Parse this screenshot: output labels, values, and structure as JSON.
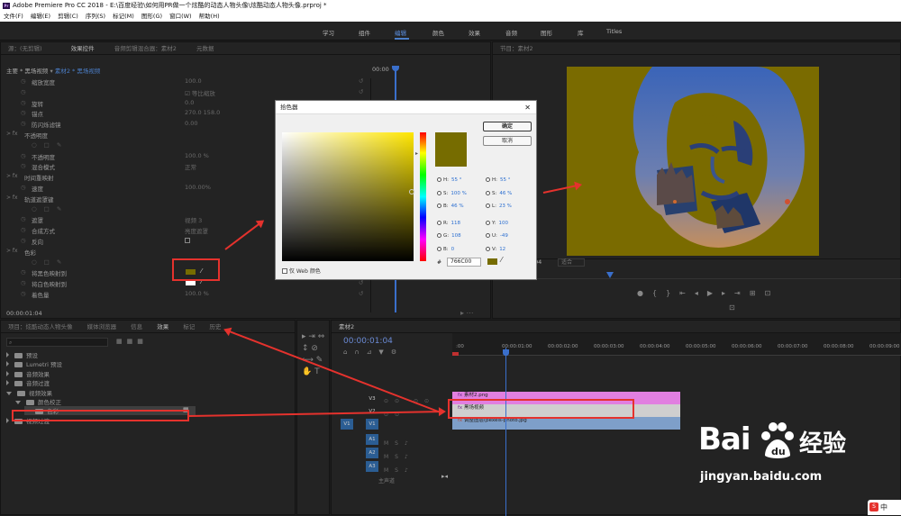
{
  "app_title": "Adobe Premiere Pro CC 2018 - E:\\百度经验\\如何用PR做一个炫酷的动态人物头像\\炫酷动态人物头像.prproj *",
  "menu": [
    "文件(F)",
    "编辑(E)",
    "剪辑(C)",
    "序列(S)",
    "标记(M)",
    "图形(G)",
    "窗口(W)",
    "帮助(H)"
  ],
  "workspaces": [
    "学习",
    "组件",
    "编辑",
    "颜色",
    "效果",
    "音频",
    "图形",
    "库",
    "Titles"
  ],
  "active_workspace": "编辑",
  "effect_controls": {
    "tabs": [
      "源：(无剪辑)",
      "效果控件",
      "音频剪辑混合器：素材2",
      "元数据"
    ],
    "clip_path": "主要 * 黑场视频",
    "clip_sel": "素材2 * 黑场视频",
    "timecode_right": "00:00",
    "rows": [
      {
        "label": "缩放宽度",
        "value": "100.0",
        "kind": "dim"
      },
      {
        "label": "",
        "value": "等比缩放",
        "kind": "check"
      },
      {
        "label": "旋转",
        "value": "0.0",
        "kind": "dim"
      },
      {
        "label": "锚点",
        "value": "270.0     158.0",
        "kind": "dim"
      },
      {
        "label": "防闪烁滤镜",
        "value": "0.00",
        "kind": "dim"
      },
      {
        "label": "不透明度",
        "value": "",
        "kind": "fx"
      },
      {
        "label": "",
        "value": "",
        "kind": "mask"
      },
      {
        "label": "不透明度",
        "value": "100.0 %",
        "kind": "dim"
      },
      {
        "label": "混合模式",
        "value": "正常",
        "kind": "dim"
      },
      {
        "label": "时间重映射",
        "value": "",
        "kind": "fx"
      },
      {
        "label": "速度",
        "value": "100.00%",
        "kind": "dim"
      },
      {
        "label": "轨道遮罩键",
        "value": "",
        "kind": "fx"
      },
      {
        "label": "",
        "value": "",
        "kind": "mask"
      },
      {
        "label": "遮罩",
        "value": "视频 3",
        "kind": "dim"
      },
      {
        "label": "合成方式",
        "value": "亮度遮罩",
        "kind": "dim"
      },
      {
        "label": "反向",
        "value": "",
        "kind": "box"
      },
      {
        "label": "色彩",
        "value": "",
        "kind": "fx"
      },
      {
        "label": "",
        "value": "",
        "kind": "mask"
      },
      {
        "label": "将黑色映射到",
        "value": "",
        "kind": "swatch-olive"
      },
      {
        "label": "将白色映射到",
        "value": "",
        "kind": "swatch-white"
      },
      {
        "label": "着色量",
        "value": "100.0 %",
        "kind": "dim"
      }
    ],
    "timecode": "00:00:01:04"
  },
  "color_picker": {
    "title": "拾色器",
    "ok": "确定",
    "cancel": "取消",
    "hsb_left": [
      [
        "H",
        "55 °"
      ],
      [
        "S",
        "100 %"
      ],
      [
        "B",
        "46 %"
      ],
      [
        "R",
        "118"
      ],
      [
        "G",
        "108"
      ],
      [
        "B",
        "0"
      ]
    ],
    "hsb_right": [
      [
        "H",
        "55 °"
      ],
      [
        "S",
        "46 %"
      ],
      [
        "L",
        "23 %"
      ],
      [
        "Y",
        "100"
      ],
      [
        "U",
        "-49"
      ],
      [
        "V",
        "12"
      ]
    ],
    "hex_label": "#",
    "hex_value": "766C00",
    "web_only": "仅 Web 颜色",
    "color": "#766C00"
  },
  "program_monitor": {
    "title": "节目：素材2",
    "timecode": "04",
    "fit": "适合"
  },
  "project_panel": {
    "tabs": [
      "项目：炫酷动态人物头像",
      "媒体浏览器",
      "信息",
      "效果",
      "标记",
      "历史"
    ],
    "items": [
      {
        "label": "预设",
        "indent": 0,
        "open": false
      },
      {
        "label": "Lumetri 预设",
        "indent": 0,
        "open": false
      },
      {
        "label": "音频效果",
        "indent": 0,
        "open": false
      },
      {
        "label": "音频过渡",
        "indent": 0,
        "open": false
      },
      {
        "label": "视频效果",
        "indent": 0,
        "open": true
      },
      {
        "label": "颜色校正",
        "indent": 1,
        "open": true
      },
      {
        "label": "色彩",
        "indent": 2,
        "open": false
      },
      {
        "label": "视频过渡",
        "indent": 0,
        "open": false
      }
    ]
  },
  "timeline": {
    "tab": "素材2",
    "timecode": "00:00:01:04",
    "ruler": [
      ":00",
      "00:00:01:00",
      "00:00:02:00",
      "00:00:03:00",
      "00:00:04:00",
      "00:00:05:00",
      "00:00:06:00",
      "00:00:07:00",
      "00:00:08:00",
      "00:00:09:00"
    ],
    "video_tracks": [
      "V3",
      "V2",
      "V1"
    ],
    "audio_tracks": [
      "A1",
      "A2",
      "A3"
    ],
    "master": "主声道",
    "clips": {
      "v3": "素材2.png",
      "v2": "黑场视频",
      "v1": "调整图层(pexels-photo.jpg"
    }
  },
  "watermark": {
    "brand": "Bai",
    "brand_cn": "经验",
    "url": "jingyan.baidu.com"
  },
  "ime": "中"
}
